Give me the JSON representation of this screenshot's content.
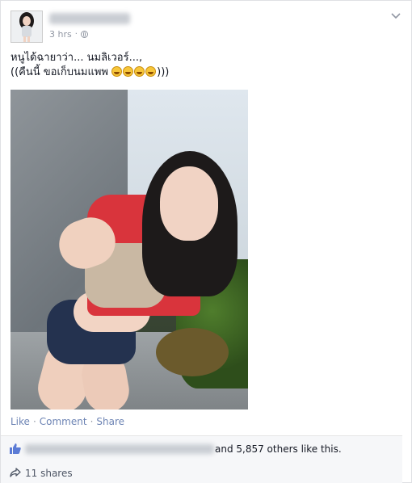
{
  "post": {
    "time": "3 hrs",
    "dot": "·",
    "text_line1": "หนูได้ฉายาว่า... นมลิเวอร์...,",
    "text_line2_prefix": "((คืนนี้ ขอเก็บนมแพพ ",
    "text_line2_suffix": ")))",
    "emoji_count": 4,
    "emoji_name": "grinning-face-emoji"
  },
  "actions": {
    "like": "Like",
    "comment": "Comment",
    "share": "Share",
    "separator": "·"
  },
  "likes": {
    "text": "and 5,857 others like this."
  },
  "shares": {
    "text": "11 shares"
  },
  "icons": {
    "options": "chevron-down-icon",
    "privacy": "globe-icon",
    "like": "thumbs-up-icon",
    "share": "share-arrow-icon"
  },
  "colors": {
    "link": "#6d84b4",
    "meta": "#9197a3",
    "text": "#141823",
    "panel": "#f6f7f9",
    "thumb": "#5b7bd5"
  }
}
